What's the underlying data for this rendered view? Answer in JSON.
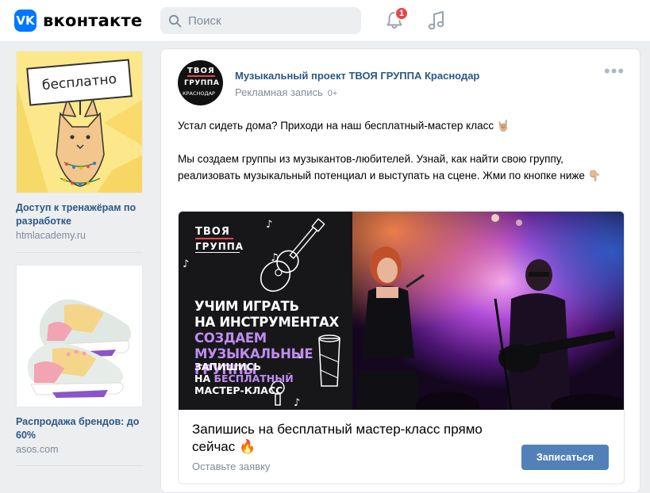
{
  "header": {
    "logo_mark": "VK",
    "logo_text": "вконтакте",
    "search_placeholder": "Поиск",
    "notifications_count": "1",
    "icons": [
      "search-icon",
      "bell-icon",
      "music-icon"
    ],
    "accent_color": "#0077ff"
  },
  "sidebar": {
    "ads": [
      {
        "image_text": "бесплатно",
        "title": "Доступ к тренажёрам по разработке",
        "domain": "htmlacademy.ru"
      },
      {
        "title": "Распродажа брендов: до 60%",
        "domain": "asos.com"
      }
    ]
  },
  "post": {
    "author": "Музыкальный проект ТВОЯ ГРУППА Краснодар",
    "label": "Рекламная запись",
    "age_rating": "0+",
    "more": "•••",
    "text_line1": "Устал сидеть дома? Приходи на наш бесплатный-мастер класс 🤘🏼",
    "text_line2": "Мы создаем группы из музыкантов-любителей. Узнай, как найти свою группу, реализовать музыкальный потенциал и выступать на сцене. Жми по кнопке ниже 👇🏼",
    "avatar_text": {
      "line1": "ТВОЯ",
      "line2": "ГРУППА",
      "line3": "КРАСНОДАР"
    },
    "banner": {
      "logo_line1": "ТВОЯ",
      "logo_line2": "ГРУППА",
      "line1": "УЧИМ ИГРАТЬ",
      "line2": "НА ИНСТРУМЕНТАХ",
      "line3": "СОЗДАЕМ",
      "line4": "МУЗЫКАЛЬНЫЕ ГРУППЫ",
      "small1": "ЗАПИШИСЬ",
      "small2a": "НА ",
      "small2b": "БЕСПЛАТНЫЙ",
      "small3": "МАСТЕР-КЛАСС"
    },
    "cta": {
      "title": "Запишись на бесплатный мастер-класс прямо сейчас 🔥",
      "subtitle": "Оставьте заявку",
      "button": "Записаться"
    }
  }
}
